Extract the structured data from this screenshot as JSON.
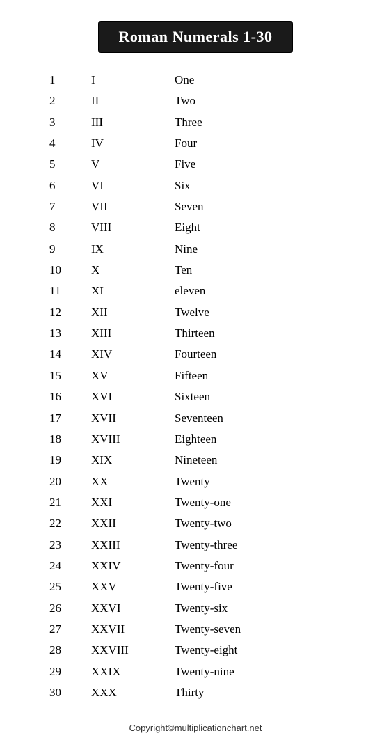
{
  "title": "Roman Numerals 1-30",
  "rows": [
    {
      "num": "1",
      "roman": "I",
      "word": "One"
    },
    {
      "num": "2",
      "roman": "II",
      "word": "Two"
    },
    {
      "num": "3",
      "roman": "III",
      "word": "Three"
    },
    {
      "num": "4",
      "roman": "IV",
      "word": "Four"
    },
    {
      "num": "5",
      "roman": "V",
      "word": "Five"
    },
    {
      "num": "6",
      "roman": "VI",
      "word": "Six"
    },
    {
      "num": "7",
      "roman": "VII",
      "word": "Seven"
    },
    {
      "num": "8",
      "roman": "VIII",
      "word": "Eight"
    },
    {
      "num": "9",
      "roman": "IX",
      "word": "Nine"
    },
    {
      "num": "10",
      "roman": "X",
      "word": "Ten"
    },
    {
      "num": "11",
      "roman": "XI",
      "word": "eleven"
    },
    {
      "num": "12",
      "roman": "XII",
      "word": "Twelve"
    },
    {
      "num": "13",
      "roman": "XIII",
      "word": "Thirteen"
    },
    {
      "num": "14",
      "roman": "XIV",
      "word": "Fourteen"
    },
    {
      "num": "15",
      "roman": "XV",
      "word": "Fifteen"
    },
    {
      "num": "16",
      "roman": "XVI",
      "word": "Sixteen"
    },
    {
      "num": "17",
      "roman": "XVII",
      "word": "Seventeen"
    },
    {
      "num": "18",
      "roman": "XVIII",
      "word": "Eighteen"
    },
    {
      "num": "19",
      "roman": "XIX",
      "word": "Nineteen"
    },
    {
      "num": "20",
      "roman": "XX",
      "word": "Twenty"
    },
    {
      "num": "21",
      "roman": "XXI",
      "word": "Twenty-one"
    },
    {
      "num": "22",
      "roman": "XXII",
      "word": "Twenty-two"
    },
    {
      "num": "23",
      "roman": "XXIII",
      "word": "Twenty-three"
    },
    {
      "num": "24",
      "roman": "XXIV",
      "word": "Twenty-four"
    },
    {
      "num": "25",
      "roman": "XXV",
      "word": "Twenty-five"
    },
    {
      "num": "26",
      "roman": "XXVI",
      "word": "Twenty-six"
    },
    {
      "num": "27",
      "roman": "XXVII",
      "word": "Twenty-seven"
    },
    {
      "num": "28",
      "roman": "XXVIII",
      "word": "Twenty-eight"
    },
    {
      "num": "29",
      "roman": "XXIX",
      "word": "Twenty-nine"
    },
    {
      "num": "30",
      "roman": "XXX",
      "word": "Thirty"
    }
  ],
  "footer": "Copyright©multiplicationchart.net"
}
